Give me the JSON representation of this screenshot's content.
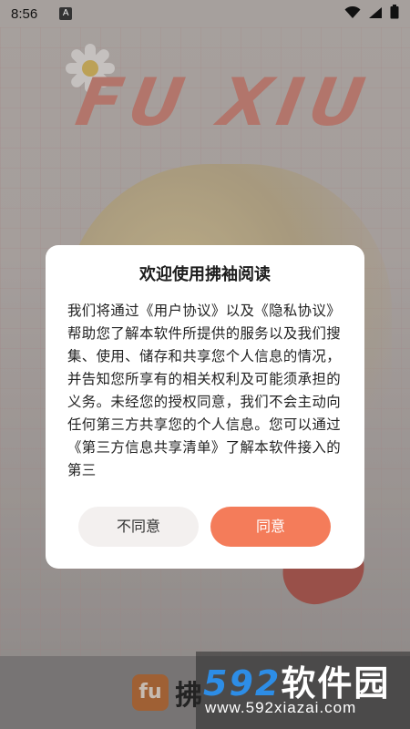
{
  "status_bar": {
    "time": "8:56",
    "indicator": "A",
    "wifi_icon": "wifi-icon",
    "signal_icon": "signal-icon",
    "battery_icon": "battery-icon"
  },
  "background": {
    "brand_art_text": "FU XIU",
    "bottom_logo_text": "fu",
    "bottom_title": "拂"
  },
  "dialog": {
    "title": "欢迎使用拂袖阅读",
    "body": "我们将通过《用户协议》以及《隐私协议》帮助您了解本软件所提供的服务以及我们搜集、使用、储存和共享您个人信息的情况，并告知您所享有的相关权利及可能须承担的义务。未经您的授权同意，我们不会主动向任何第三方共享您的个人信息。您可以通过《第三方信息共享清单》了解本软件接入的第三",
    "decline_label": "不同意",
    "agree_label": "同意"
  },
  "watermark": {
    "number": "592",
    "cn": "软件园",
    "url": "www.592xiazai.com"
  },
  "colors": {
    "agree_button": "#f47c5a",
    "decline_button": "#f3f0ef",
    "watermark_blue": "#2d8de6"
  }
}
